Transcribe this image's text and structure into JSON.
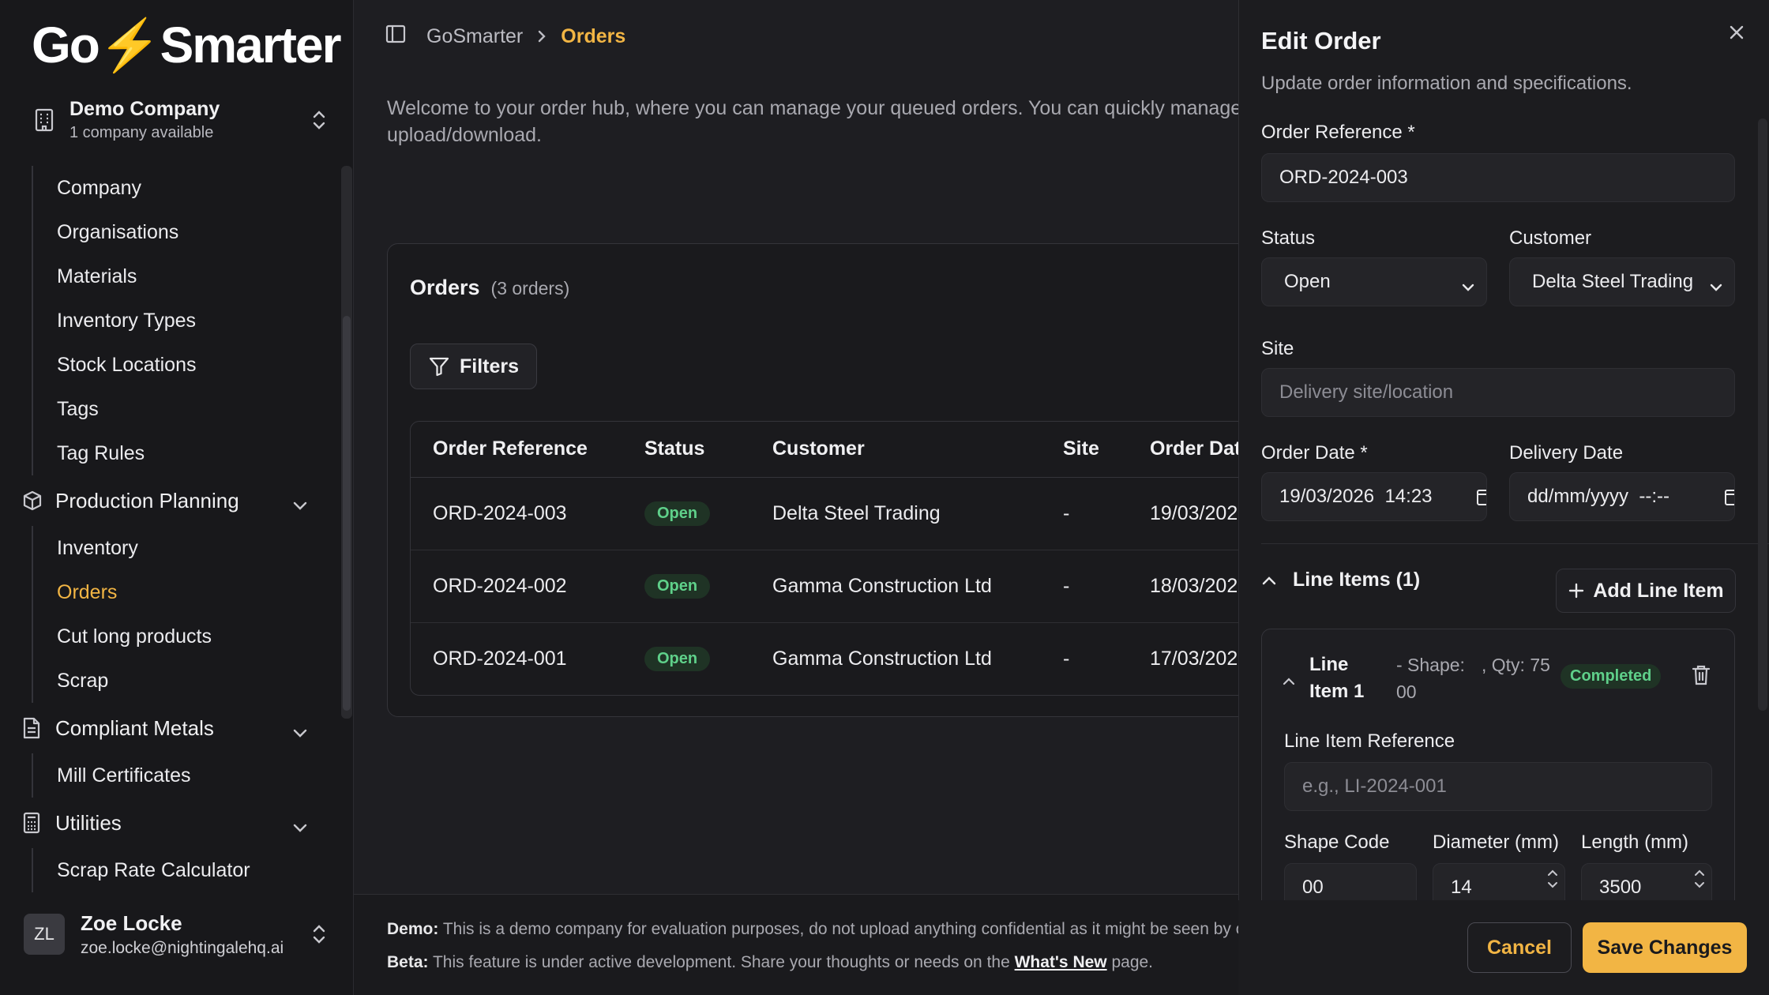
{
  "app": {
    "logo_left": "Go",
    "logo_right": "Smarter"
  },
  "company": {
    "name": "Demo Company",
    "sub": "1 company available"
  },
  "sidebar": {
    "top_items": [
      "Company",
      "Organisations",
      "Materials",
      "Inventory Types",
      "Stock Locations",
      "Tags",
      "Tag Rules"
    ],
    "sections": [
      {
        "label": "Production Planning",
        "items": [
          "Inventory",
          "Orders",
          "Cut long products",
          "Scrap"
        ]
      },
      {
        "label": "Compliant Metals",
        "items": [
          "Mill Certificates"
        ]
      },
      {
        "label": "Utilities",
        "items": [
          "Scrap Rate Calculator"
        ]
      }
    ],
    "active_item": "Orders"
  },
  "user": {
    "initials": "ZL",
    "name": "Zoe Locke",
    "email": "zoe.locke@nightingalehq.ai"
  },
  "breadcrumb": {
    "root": "GoSmarter",
    "current": "Orders"
  },
  "intro": {
    "line1": "Welcome to your order hub, where you can manage your queued orders. You can quickly manage yo",
    "line2": "upload/download."
  },
  "orders": {
    "title": "Orders",
    "count": "(3 orders)",
    "filters_label": "Filters",
    "columns": [
      "Order Reference",
      "Status",
      "Customer",
      "Site",
      "Order Dat"
    ],
    "rows": [
      {
        "ref": "ORD-2024-003",
        "status": "Open",
        "customer": "Delta Steel Trading",
        "site": "-",
        "date": "19/03/202"
      },
      {
        "ref": "ORD-2024-002",
        "status": "Open",
        "customer": "Gamma Construction Ltd",
        "site": "-",
        "date": "18/03/202"
      },
      {
        "ref": "ORD-2024-001",
        "status": "Open",
        "customer": "Gamma Construction Ltd",
        "site": "-",
        "date": "17/03/202"
      }
    ]
  },
  "footer": {
    "demo_label": "Demo:",
    "demo_text": "This is a demo company for evaluation purposes, do not upload anything confidential as it might be seen by o",
    "beta_label": "Beta:",
    "beta_text": "This feature is under active development. Share your thoughts or needs on the",
    "beta_link": "What's New",
    "beta_tail": "page."
  },
  "drawer": {
    "title": "Edit Order",
    "subtitle": "Update order information and specifications.",
    "order_ref_label": "Order Reference *",
    "order_ref_value": "ORD-2024-003",
    "status_label": "Status",
    "status_value": "Open",
    "customer_label": "Customer",
    "customer_value": "Delta Steel Trading",
    "site_label": "Site",
    "site_placeholder": "Delivery site/location",
    "order_date_label": "Order Date *",
    "order_date_value": "19/03/2026  14:23",
    "delivery_date_label": "Delivery Date",
    "delivery_date_value": "dd/mm/yyyy  --:--",
    "line_items_label": "Line Items (1)",
    "add_line_item": "Add Line Item",
    "line_item": {
      "title": "Line Item 1",
      "shape_meta": "- Shape: 00",
      "qty_meta": ", Qty: 75",
      "status": "Completed",
      "ref_label": "Line Item Reference",
      "ref_placeholder": "e.g., LI-2024-001",
      "shape_label": "Shape Code",
      "shape_value": "00",
      "diameter_label": "Diameter (mm)",
      "diameter_value": "14",
      "length_label": "Length (mm)",
      "length_value": "3500"
    },
    "cancel": "Cancel",
    "save": "Save Changes"
  },
  "colors": {
    "accent": "#f2b544",
    "status_open": "#5fd08a",
    "background": "#1c1c1f"
  }
}
